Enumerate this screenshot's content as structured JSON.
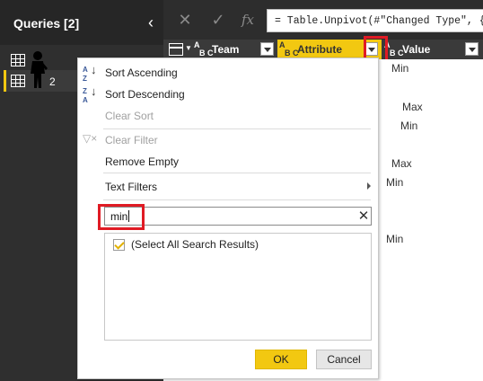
{
  "queries_pane": {
    "title": "Queries [2]",
    "collapse_icon": "chevron-left-icon",
    "items": [
      {
        "name": "",
        "icon": "table-icon"
      },
      {
        "name": "2",
        "icon": "table-icon"
      }
    ]
  },
  "formula_bar": {
    "cancel_icon": "close-icon",
    "commit_icon": "check-icon",
    "fx_label": "fx",
    "formula": "= Table.Unpivot(#\"Changed Type\", {\""
  },
  "columns": [
    {
      "type_label": "ABC",
      "name": "Team"
    },
    {
      "type_label": "ABC",
      "name": "Attribute",
      "selected_color": "#f2c811"
    },
    {
      "type_label": "ABC",
      "name": "Value"
    }
  ],
  "attribute_cells": [
    "Min",
    "",
    "Max",
    "Min",
    "",
    "Max",
    "Min",
    "",
    "",
    "Min"
  ],
  "filter_menu": {
    "sort_ascending": "Sort Ascending",
    "sort_descending": "Sort Descending",
    "clear_sort": "Clear Sort",
    "clear_filter": "Clear Filter",
    "remove_empty": "Remove Empty",
    "text_filters": "Text Filters",
    "search_value": "min",
    "select_all_results": "(Select All Search Results)",
    "select_all_checked": true,
    "ok": "OK",
    "cancel": "Cancel"
  },
  "colors": {
    "accent": "#f2c811",
    "highlight": "#e01b24",
    "pane_dark": "#2d2d2d"
  }
}
